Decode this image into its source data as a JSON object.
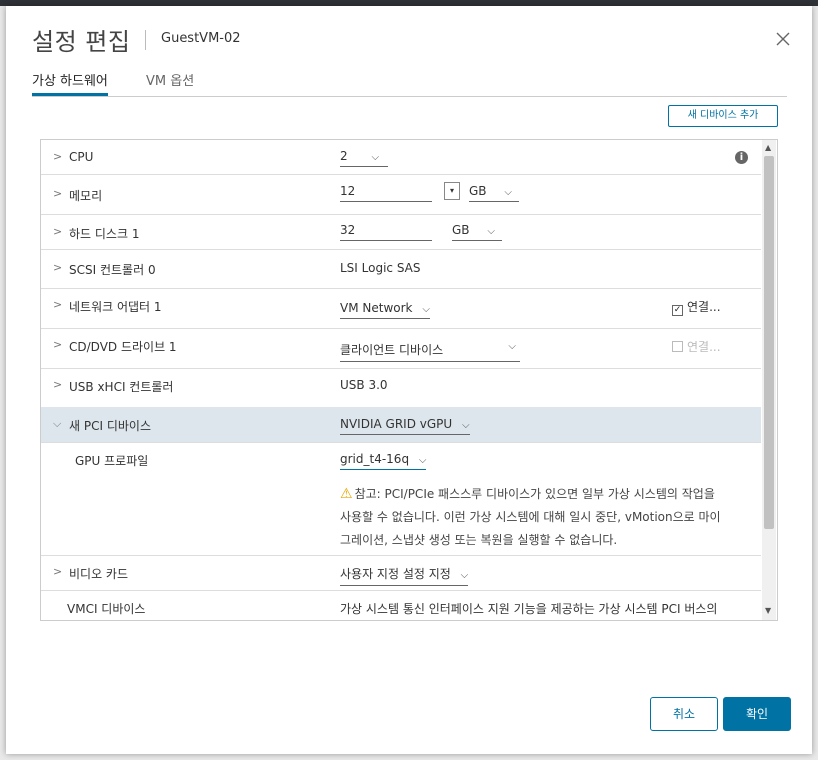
{
  "dialog": {
    "title": "설정 편집",
    "vm_name": "GuestVM-02",
    "close_icon": "close-icon"
  },
  "tabs": [
    {
      "label": "가상 하드웨어",
      "active": true
    },
    {
      "label": "VM 옵션",
      "active": false
    }
  ],
  "add_device_label": "새 디바이스 추가",
  "rows": {
    "cpu": {
      "label": "CPU",
      "value": "2"
    },
    "memory": {
      "label": "메모리",
      "value": "12",
      "unit": "GB"
    },
    "disk": {
      "label": "하드 디스크 1",
      "value": "32",
      "unit": "GB"
    },
    "scsi": {
      "label": "SCSI 컨트롤러 0",
      "value": "LSI Logic SAS"
    },
    "network": {
      "label": "네트워크 어댑터 1",
      "value": "VM Network",
      "connect_label": "연결...",
      "connected": true
    },
    "cdrom": {
      "label": "CD/DVD 드라이브 1",
      "value": "클라이언트 디바이스",
      "connect_label": "연결...",
      "connected": false
    },
    "usb": {
      "label": "USB xHCI 컨트롤러",
      "value": "USB 3.0"
    },
    "pci": {
      "label": "새 PCI 디바이스",
      "value": "NVIDIA GRID vGPU"
    },
    "gpu_profile": {
      "label": "GPU 프로파일",
      "value": "grid_t4-16q"
    },
    "note": {
      "line1": "참고: PCI/PCIe 패스스루 디바이스가 있으면 일부 가상 시스템의 작업을",
      "line2": "사용할 수 없습니다. 이런 가상 시스템에 대해 일시 중단, vMotion으로 마이",
      "line3": "그레이션, 스냅샷 생성 또는 복원을 실행할 수 없습니다."
    },
    "video": {
      "label": "비디오 카드",
      "value": "사용자 지정 설정 지정"
    },
    "vmci": {
      "label": "VMCI 디바이스",
      "value": "가상 시스템 통신 인터페이스 지원 기능을 제공하는 가상 시스템 PCI 버스의"
    }
  },
  "buttons": {
    "cancel": "취소",
    "ok": "확인"
  },
  "colors": {
    "accent": "#0072a3",
    "selected_row": "#dde6ec",
    "warning": "#e6a700"
  }
}
